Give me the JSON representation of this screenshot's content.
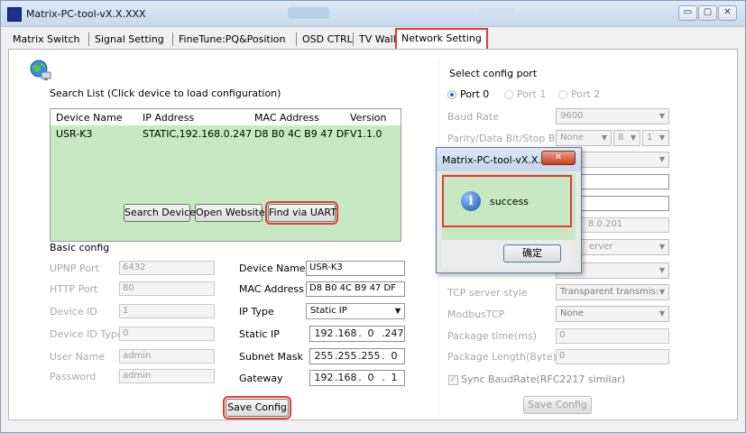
{
  "window": {
    "title": "Matrix-PC-tool-vX.X.XXX",
    "min_glyph": "▭",
    "max_glyph": "▢",
    "close_glyph": "✕"
  },
  "tabs": [
    "Matrix Switch",
    "Signal Setting",
    "FineTune:PQ&Position",
    "OSD CTRL",
    "TV Wall",
    "Network Setting"
  ],
  "search": {
    "title": "Search List (Click device to load configuration)",
    "columns": [
      "Device Name",
      "IP Address",
      "MAC Address",
      "Version"
    ],
    "rows": [
      [
        "USR-K3",
        "STATIC,192.168.0.247",
        "D8 B0 4C B9 47 DF",
        "V1.1.0"
      ]
    ],
    "buttons": {
      "search": "Search Device",
      "website": "Open Website",
      "uart": "Find via UART"
    }
  },
  "basic": {
    "title": "Basic config",
    "upnp_label": "UPNP Port",
    "upnp_value": "6432",
    "http_label": "HTTP Port",
    "http_value": "80",
    "devid_label": "Device ID",
    "devid_value": "1",
    "devidtype_label": "Device ID Type",
    "devidtype_value": "0",
    "user_label": "User Name",
    "user_value": "admin",
    "pass_label": "Password",
    "pass_value": "admin",
    "devname_label": "Device Name",
    "devname_value": "USR-K3",
    "mac_label": "MAC Address",
    "mac_value": "D8 B0 4C B9 47 DF",
    "iptype_label": "IP Type",
    "iptype_value": "Static IP",
    "staticip_label": "Static IP",
    "staticip": [
      "192",
      "168",
      "0",
      "247"
    ],
    "subnet_label": "Subnet Mask",
    "subnet": [
      "255",
      "255",
      "255",
      "0"
    ],
    "gateway_label": "Gateway",
    "gateway": [
      "192",
      "168",
      "0",
      "1"
    ],
    "save_label": "Save Config"
  },
  "port": {
    "title": "Select config port",
    "ports": [
      "Port 0",
      "Port 1",
      "Port 2"
    ],
    "selected_port": "Port 0",
    "baud_label": "Baud Rate",
    "baud_value": "9600",
    "parity_label": "Parity/Data Bit/Stop Bit",
    "parity_value": "None",
    "databit_value": "8",
    "stopbit_value": "1",
    "ip_partial": "8.0.201",
    "work_partial": "erver",
    "tcpstyle_label": "TCP server style",
    "tcpstyle_value": "Transparent transmis:",
    "modbus_label": "ModbusTCP",
    "modbus_value": "None",
    "pkgtime_label": "Package time(ms)",
    "pkgtime_value": "0",
    "pkglen_label": "Package Length(Byte)",
    "pkglen_value": "0",
    "sync_label": "Sync BaudRate(RFC2217 similar)",
    "save_label": "Save Config"
  },
  "dialog": {
    "title": "Matrix-PC-tool-vX.X.X...",
    "message": "success",
    "ok_label": "确定",
    "close_glyph": "✕"
  },
  "colors": {
    "highlight_red": "#e03b3b",
    "row_green": "#c6e9c1"
  }
}
